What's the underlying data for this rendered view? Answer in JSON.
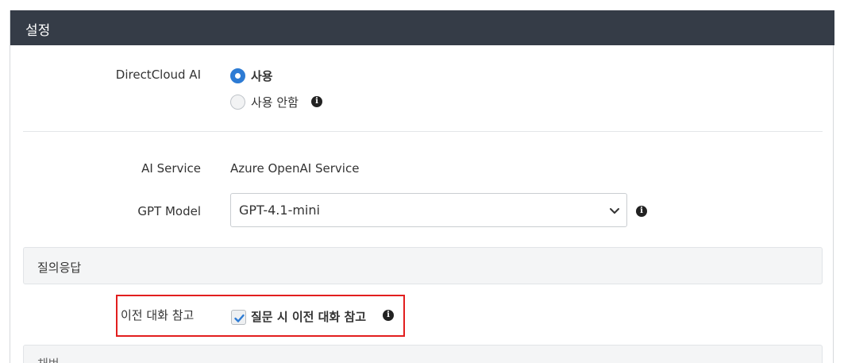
{
  "header": {
    "title": "설정"
  },
  "ai": {
    "label": "DirectCloud AI",
    "options": [
      {
        "label": "사용",
        "checked": true
      },
      {
        "label": "사용 안함",
        "checked": false
      }
    ]
  },
  "service": {
    "label": "AI Service",
    "value": "Azure OpenAI Service"
  },
  "model": {
    "label": "GPT Model",
    "selected": "GPT-4.1-mini"
  },
  "sections": {
    "qa": "질의응답",
    "next": "채번"
  },
  "history": {
    "label": "이전 대화 참고",
    "checkbox_label": "질문 시 이전 대화 참고",
    "checked": true
  },
  "icons": {
    "info": "i",
    "info_name": "info-icon",
    "chevron_name": "chevron-down-icon",
    "check_name": "checkmark-icon"
  },
  "colors": {
    "header_bg": "#353c47",
    "accent": "#2d7bd4",
    "highlight": "#e21e1e"
  }
}
